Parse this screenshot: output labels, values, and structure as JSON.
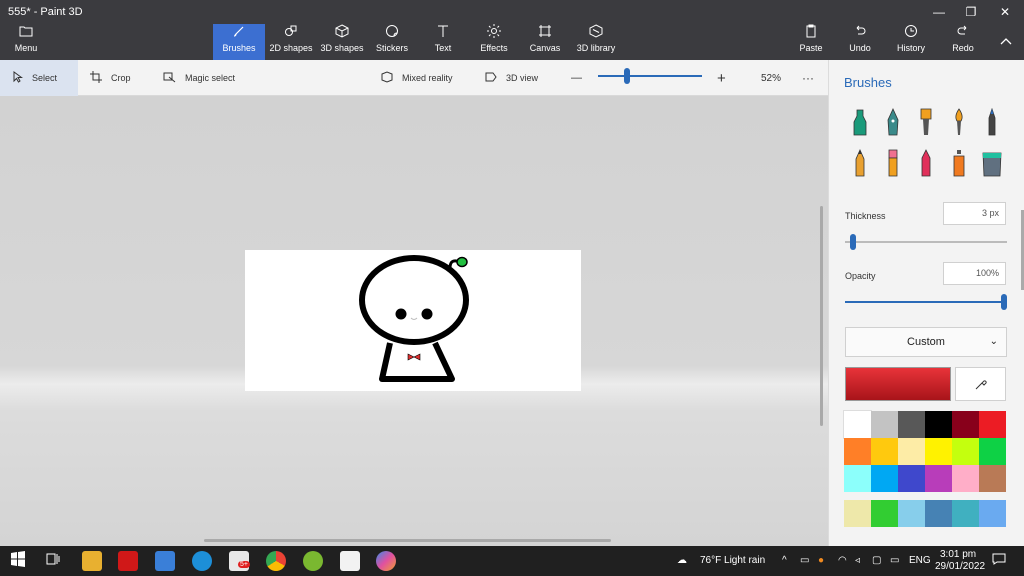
{
  "window": {
    "title": "555* - Paint 3D",
    "minimize": "—",
    "maximize": "❐",
    "close": "✕"
  },
  "ribbon": {
    "menu": "Menu",
    "tabs": [
      {
        "label": "Brushes"
      },
      {
        "label": "2D shapes"
      },
      {
        "label": "3D shapes"
      },
      {
        "label": "Stickers"
      },
      {
        "label": "Text"
      },
      {
        "label": "Effects"
      },
      {
        "label": "Canvas"
      },
      {
        "label": "3D library"
      }
    ],
    "right": [
      {
        "label": "Paste"
      },
      {
        "label": "Undo"
      },
      {
        "label": "History"
      },
      {
        "label": "Redo"
      }
    ],
    "collapse": "^"
  },
  "toolbar": {
    "select": "Select",
    "crop": "Crop",
    "magic_select": "Magic select",
    "mixed_reality": "Mixed reality",
    "view_3d": "3D view",
    "zoom_minus": "—",
    "zoom_plus": "+",
    "zoom": "52%",
    "more": "···",
    "zoom_level": 0.27
  },
  "panel": {
    "title": "Brushes",
    "thickness_label": "Thickness",
    "thickness_value": "3 px",
    "opacity_label": "Opacity",
    "opacity_value": "100%",
    "preset": "Custom",
    "preset_chevron": "⌄",
    "thickness_level": 0.03,
    "opacity_level": 1.0,
    "current_color": "#d4212a",
    "palette": [
      "#ffffff",
      "#c3c3c3",
      "#585858",
      "#000000",
      "#88001b",
      "#ec1c24",
      "#ff7f27",
      "#ffc90e",
      "#fdeca6",
      "#fff200",
      "#c4ff0e",
      "#0ed145",
      "#8cfffb",
      "#00a8f3",
      "#3f48cc",
      "#b83dba",
      "#ffaec8",
      "#b97a56",
      "#eee8aa",
      "#32cd32",
      "#87ceeb",
      "#4682b4",
      "#40b0c0",
      "#6aaaf0"
    ]
  },
  "taskbar": {
    "weather": "76°F  Light rain",
    "lang": "ENG",
    "time": "3:01 pm",
    "date": "29/01/2022",
    "badge": "5+"
  },
  "colors": {
    "accent": "#2a6ab8",
    "ribbon": "#3b3b3f",
    "active_tab": "#3c6fd1"
  }
}
